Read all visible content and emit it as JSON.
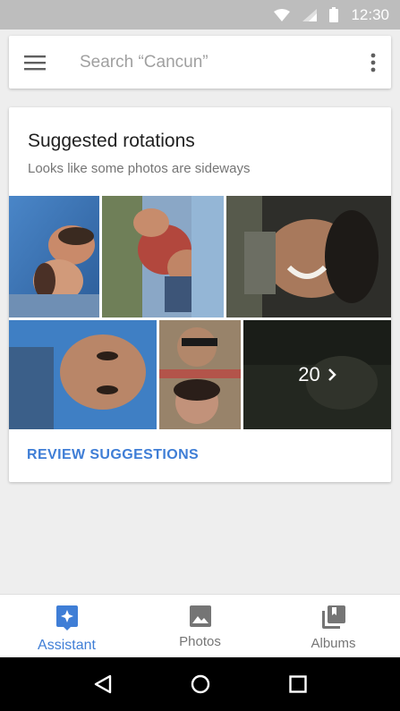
{
  "status_bar": {
    "time": "12:30"
  },
  "search": {
    "placeholder": "Search “Cancun”"
  },
  "card": {
    "title": "Suggested rotations",
    "subtitle": "Looks like some photos are sideways",
    "more_count": "20",
    "action_label": "REVIEW SUGGESTIONS"
  },
  "bottom_nav": [
    {
      "label": "Assistant",
      "icon": "assistant-icon",
      "active": true
    },
    {
      "label": "Photos",
      "icon": "photos-icon",
      "active": false
    },
    {
      "label": "Albums",
      "icon": "albums-icon",
      "active": false
    }
  ],
  "colors": {
    "accent": "#3f7ed6",
    "status_bar": "#bdbdbd",
    "background": "#eeeeee"
  }
}
